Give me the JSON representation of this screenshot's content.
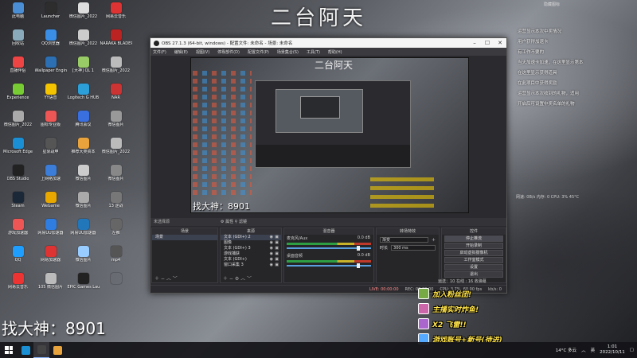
{
  "watermark": "二台阿天",
  "streamer_name": "找大神：8901",
  "top_right_text": "隐藏图标",
  "desktop_icons": [
    {
      "label": "此电脑",
      "color": "#4a8fd6"
    },
    {
      "label": "Launcher",
      "color": "#2d2d2d"
    },
    {
      "label": "微信图片_2022",
      "color": "#ddd"
    },
    {
      "label": "网易云音乐",
      "color": "#d33"
    },
    {
      "label": "回收站",
      "color": "#8ab"
    },
    {
      "label": "QQ浏览器",
      "color": "#3a8ee6"
    },
    {
      "label": "微信图片_2022",
      "color": "#ccc"
    },
    {
      "label": "NARAKA BLADEPOI",
      "color": "#b22"
    },
    {
      "label": "直播伴侣",
      "color": "#e44"
    },
    {
      "label": "Wallpaper Engine",
      "color": "#2d6fb3"
    },
    {
      "label": "[大神] QL 1",
      "color": "#9c6"
    },
    {
      "label": "微信图片_2022",
      "color": "#bbb"
    },
    {
      "label": "Experience",
      "color": "#7c3"
    },
    {
      "label": "YY语音",
      "color": "#f5c400"
    },
    {
      "label": "Logitech G HUB",
      "color": "#2c9ed8"
    },
    {
      "label": "NAR",
      "color": "#c33"
    },
    {
      "label": "微信图片_2022",
      "color": "#aaa"
    },
    {
      "label": "图标专业版",
      "color": "#e55"
    },
    {
      "label": "腾讯会议",
      "color": "#3a6fe0"
    },
    {
      "label": "微信图片",
      "color": "#999"
    },
    {
      "label": "Microsoft Edge",
      "color": "#1a8fd4"
    },
    {
      "label": "星际战甲",
      "color": "#555"
    },
    {
      "label": "推荐大类资本",
      "color": "#e8a33d"
    },
    {
      "label": "微信图片_2022",
      "color": "#bbb"
    },
    {
      "label": "OBS Studio",
      "color": "#222"
    },
    {
      "label": "上网络加速",
      "color": "#3b7dd8"
    },
    {
      "label": "微信图片",
      "color": "#ccc"
    },
    {
      "label": "微信图片",
      "color": "#888"
    },
    {
      "label": "Steam",
      "color": "#1b2838"
    },
    {
      "label": "WeGame",
      "color": "#e8a800"
    },
    {
      "label": "微信图片",
      "color": "#aaa"
    },
    {
      "label": "13 逆战",
      "color": "#777"
    },
    {
      "label": "游戏加速器",
      "color": "#e55"
    },
    {
      "label": "网易UU加速器",
      "color": "#2f7de1"
    },
    {
      "label": "网易UU加速器",
      "color": "#27b"
    },
    {
      "label": "左推",
      "color": "#666"
    },
    {
      "label": "QQ",
      "color": "#1e9fff"
    },
    {
      "label": "网易加速器",
      "color": "#d33"
    },
    {
      "label": "微信图片",
      "color": "#9cf"
    },
    {
      "label": "mp4",
      "color": "#555"
    },
    {
      "label": "网易云音乐",
      "color": "#e33"
    },
    {
      "label": "105 微信图片",
      "color": "#bbb"
    },
    {
      "label": "EPIC Games Launcher",
      "color": "#222"
    },
    {
      "label": "",
      "color": "transparent"
    }
  ],
  "right_widget": [
    "运营显示本次中奖情况",
    "用户获得加速卡",
    "有工作不要的",
    "当天加速卡加速，在这里显示第本",
    "在这里显示获得道具",
    "在此项目中获得奖励",
    "运营显示本次收到的礼物，适用",
    "开启后可设置中奖名单的礼物"
  ],
  "side_stats": "网速: 0B/s  内存: 0  CPU: 3%  45°C",
  "obs": {
    "title": "OBS 27.1.3 (64-bit, windows) - 配置文件: 未命名 - 场景: 未命名",
    "menu": [
      "文件(F)",
      "编辑(E)",
      "视图(V)",
      "停靠部件(D)",
      "配置文件(P)",
      "场景集合(S)",
      "工具(T)",
      "帮助(H)"
    ],
    "preview_watermark": "二台阿天",
    "preview_name": "找大神：8901",
    "no_source": "未选择源",
    "props_label": "属性",
    "filters_label": "滤镜",
    "docks": {
      "scenes": {
        "header": "场景",
        "items": [
          "场景"
        ]
      },
      "sources": {
        "header": "来源",
        "items": [
          "文本 (GDI+) 2",
          "图像",
          "文本 (GDI+) 3",
          "游戏捕获",
          "文本 (GDI+)",
          "窗口采集 3"
        ]
      },
      "mixer": {
        "header": "混音器",
        "channels": [
          {
            "name": "麦克风/Aux",
            "db": "0.0 dB"
          },
          {
            "name": "桌面音频",
            "db": "0.0 dB"
          }
        ]
      },
      "transitions": {
        "header": "转场特效",
        "type": "渐变",
        "duration_label": "时长",
        "duration": "300 ms"
      },
      "controls": {
        "header": "控件",
        "buttons": [
          "停止推流",
          "开始录制",
          "启动虚拟摄像机",
          "工作室模式",
          "设置",
          "退出"
        ]
      }
    },
    "status": {
      "live": "LIVE: 00:00:00",
      "rec": "REC: 00:00:00",
      "cpu": "CPU: 3.7%, 60.00 fps",
      "kbps": "kb/s: 0"
    }
  },
  "chat": {
    "header": "运送：10 在线 : 16 收弹幕",
    "messages": [
      {
        "text": "加入粉丝团!",
        "avatar": "#7a4"
      },
      {
        "text": "主播实时炸鱼!",
        "avatar": "#c6a"
      },
      {
        "text": "X2 飞雷!!",
        "avatar": "#a6c"
      },
      {
        "text": "游戏账号+新号(待进)",
        "avatar": "#5af"
      }
    ]
  },
  "taskbar": {
    "apps": [
      {
        "name": "edge",
        "color": "#1a8fd4"
      },
      {
        "name": "obs",
        "color": "#444"
      },
      {
        "name": "folder",
        "color": "#e8a33d"
      }
    ],
    "weather": "14°C 多云",
    "ime": "英",
    "time": "1:01",
    "date": "2022/10/11"
  }
}
